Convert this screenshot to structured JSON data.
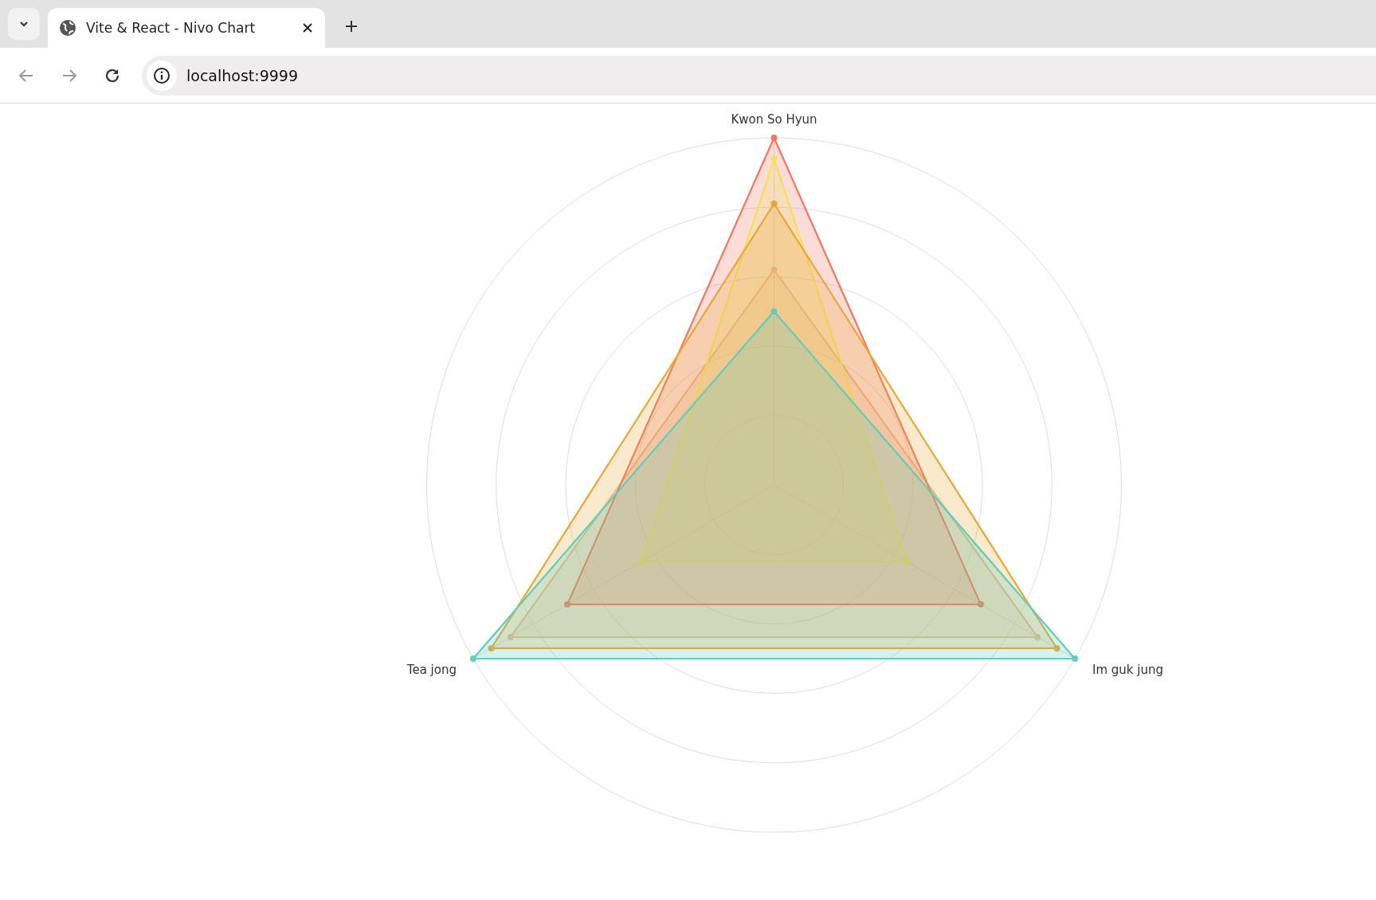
{
  "browser": {
    "tab_title": "Vite & React - Nivo Chart",
    "url": "localhost:9999"
  },
  "chart": {
    "axes": [
      "Kwon So Hyun",
      "Im guk jung",
      "Tea jong"
    ]
  }
}
